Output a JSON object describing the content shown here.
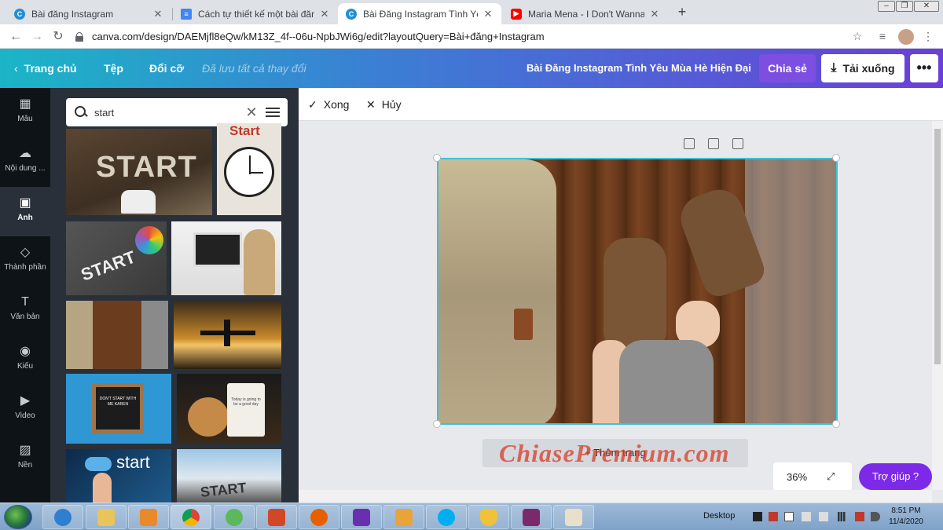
{
  "browser": {
    "tabs": [
      {
        "title": "Bài đăng Instagram",
        "favicon": "canva-icon",
        "color": "#1f8fd6",
        "active": false
      },
      {
        "title": "Cách tự thiết kế một bài đăng về",
        "favicon": "docs-icon",
        "color": "#4285f4",
        "active": false
      },
      {
        "title": "Bài Đăng Instagram Tình Yêu Mù",
        "favicon": "canva-icon",
        "color": "#1f8fd6",
        "active": true
      },
      {
        "title": "Maria Mena - I Don't Wanna See",
        "favicon": "youtube-icon",
        "color": "#ff0000",
        "active": false
      }
    ],
    "new_tab": "+",
    "url": "canva.com/design/DAEMjfl8eQw/kM13Z_4f--06u-NpbJWi6g/edit?layoutQuery=Bài+đăng+Instagram"
  },
  "canva_bar": {
    "home": "Trang chủ",
    "file": "Tệp",
    "resize": "Đổi cỡ",
    "saved": "Đã lưu tất cả thay đổi",
    "design_title": "Bài Đăng Instagram Tình Yêu Mùa Hè Hiện Đại",
    "share": "Chia sẻ",
    "download": "Tải xuống",
    "more": "•••"
  },
  "rail": [
    {
      "label": "Mẫu",
      "icon": "template-icon",
      "glyph": "▦",
      "active": false
    },
    {
      "label": "Nội dung ...",
      "icon": "upload-icon",
      "glyph": "☁",
      "active": false
    },
    {
      "label": "Ảnh",
      "icon": "photo-icon",
      "glyph": "▣",
      "active": true
    },
    {
      "label": "Thành phần",
      "icon": "elements-icon",
      "glyph": "◇",
      "active": false
    },
    {
      "label": "Văn bản",
      "icon": "text-icon",
      "glyph": "T",
      "active": false
    },
    {
      "label": "Kiểu",
      "icon": "styles-icon",
      "glyph": "◉",
      "active": false
    },
    {
      "label": "Video",
      "icon": "video-icon",
      "glyph": "▶",
      "active": false
    },
    {
      "label": "Nền",
      "icon": "background-icon",
      "glyph": "▨",
      "active": false
    }
  ],
  "panel": {
    "search_value": "start",
    "thumb_texts": {
      "start_sand": "START",
      "start_clock": "Start",
      "start_road": "START",
      "sign_text": "DON'T START WITH ME KAREN",
      "cup_text": "Today is going to be a good day",
      "start_hand": "start",
      "start_road2": "START"
    }
  },
  "editor": {
    "done": "Xong",
    "cancel": "Hủy",
    "add_page": "+ Thêm trang",
    "zoom": "36%",
    "help": "Trợ giúp ?",
    "watermark": "ChiasePremium.com"
  },
  "taskbar": {
    "desktop": "Desktop",
    "time": "8:51 PM",
    "date": "11/4/2020"
  },
  "colors": {
    "canva_gradient_start": "#1bb5c6",
    "canva_gradient_end": "#6a3fd8",
    "share_button": "#7d4fe0",
    "help_button": "#7d2ae8",
    "selection": "#3ac3d4"
  }
}
